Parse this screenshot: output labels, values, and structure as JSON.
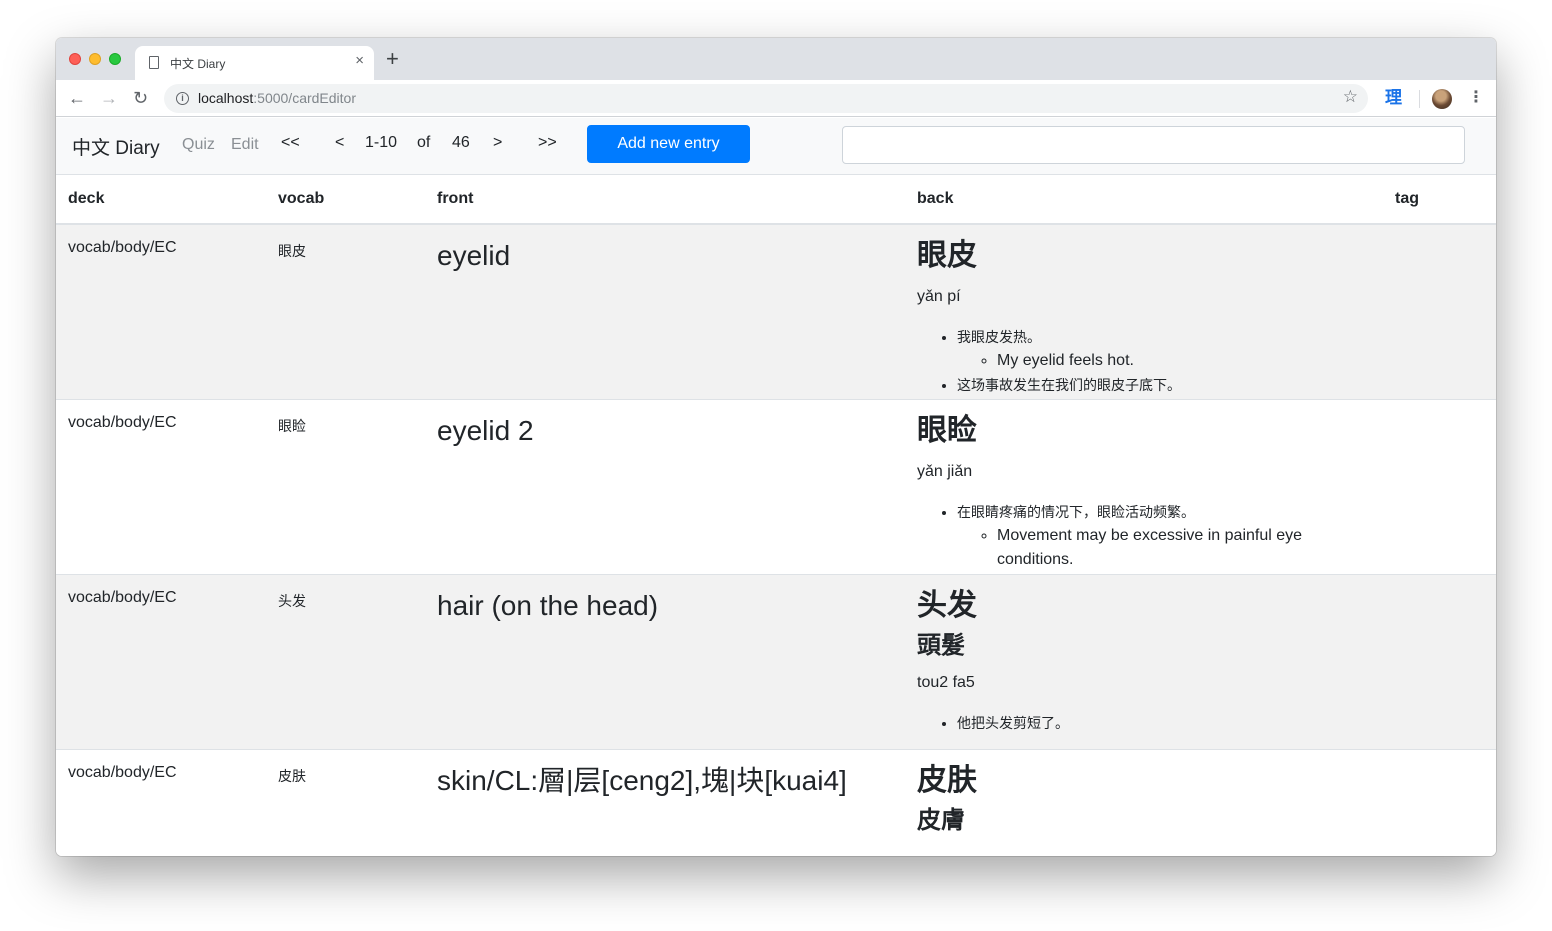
{
  "browser": {
    "tab_title": "中文 Diary",
    "tab_close": "×",
    "new_tab": "+",
    "url_host": "localhost",
    "url_path": ":5000/cardEditor",
    "extension_label": "理"
  },
  "nav": {
    "brand": "中文 Diary",
    "quiz": "Quiz",
    "edit": "Edit",
    "first": "<<",
    "prev": "<",
    "range": "1-10",
    "of": "of",
    "total": "46",
    "next": ">",
    "last": ">>",
    "add_button": "Add new entry",
    "search_value": ""
  },
  "table": {
    "headers": {
      "deck": "deck",
      "vocab": "vocab",
      "front": "front",
      "back": "back",
      "tag": "tag"
    },
    "rows": [
      {
        "deck": "vocab/body/EC",
        "vocab": "眼皮",
        "front": "eyelid",
        "back_title": "眼皮",
        "back_subtitle": "",
        "pinyin": "yǎn pí",
        "ex1": "我眼皮发热。",
        "ex1_en": "My eyelid feels hot.",
        "ex2": "这场事故发生在我们的眼皮子底下。",
        "tag": ""
      },
      {
        "deck": "vocab/body/EC",
        "vocab": "眼睑",
        "front": "eyelid 2",
        "back_title": "眼睑",
        "back_subtitle": "",
        "pinyin": "yǎn jiǎn",
        "ex1": "在眼睛疼痛的情况下，眼睑活动频繁。",
        "ex1_en": "Movement may be excessive in painful eye conditions.",
        "ex2": "",
        "tag": ""
      },
      {
        "deck": "vocab/body/EC",
        "vocab": "头发",
        "front": "hair (on the head)",
        "back_title": "头发",
        "back_subtitle": "頭髮",
        "pinyin": "tou2 fa5",
        "ex1": "他把头发剪短了。",
        "ex1_en": "",
        "ex2": "",
        "tag": ""
      },
      {
        "deck": "vocab/body/EC",
        "vocab": "皮肤",
        "front": "skin/CL:層|层[ceng2],塊|块[kuai4]",
        "back_title": "皮肤",
        "back_subtitle": "皮膚",
        "pinyin": "",
        "ex1": "",
        "ex1_en": "",
        "ex2": "",
        "tag": ""
      }
    ]
  },
  "colors": {
    "primary": "#007bff",
    "stripe": "#f2f2f2",
    "navbar": "#f8f9fa",
    "muted_link": "#8a8f94"
  },
  "icons": [
    "back-arrow-icon",
    "forward-arrow-icon",
    "reload-icon",
    "info-icon",
    "star-icon",
    "menu-icon",
    "document-icon"
  ]
}
